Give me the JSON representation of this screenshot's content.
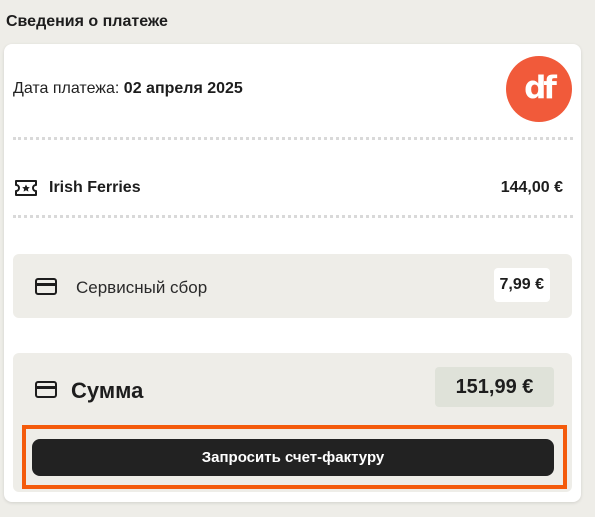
{
  "section": {
    "title": "Сведения о платеже"
  },
  "payment": {
    "date_label": "Дата платежа:",
    "date_value": "02 апреля 2025"
  },
  "logo": {
    "text": "df",
    "color": "#f15a3a"
  },
  "product": {
    "icon": "ticket-icon",
    "name": "Irish Ferries",
    "price": "144,00 €"
  },
  "service_fee": {
    "icon": "credit-card-icon",
    "label": "Сервисный сбор",
    "value": "7,99 €"
  },
  "total": {
    "icon": "credit-card-icon",
    "label": "Сумма",
    "value": "151,99 €"
  },
  "invoice_button": {
    "label": "Запросить счет-фактуру",
    "highlight_color": "#f45b0c"
  }
}
